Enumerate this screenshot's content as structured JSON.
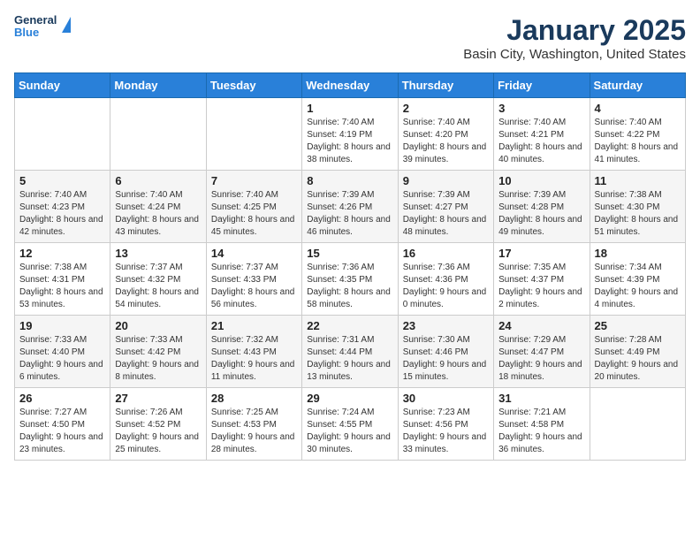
{
  "header": {
    "logo_line1": "General",
    "logo_line2": "Blue",
    "title": "January 2025",
    "subtitle": "Basin City, Washington, United States"
  },
  "calendar": {
    "days_of_week": [
      "Sunday",
      "Monday",
      "Tuesday",
      "Wednesday",
      "Thursday",
      "Friday",
      "Saturday"
    ],
    "weeks": [
      [
        {
          "day": "",
          "content": ""
        },
        {
          "day": "",
          "content": ""
        },
        {
          "day": "",
          "content": ""
        },
        {
          "day": "1",
          "content": "Sunrise: 7:40 AM\nSunset: 4:19 PM\nDaylight: 8 hours and 38 minutes."
        },
        {
          "day": "2",
          "content": "Sunrise: 7:40 AM\nSunset: 4:20 PM\nDaylight: 8 hours and 39 minutes."
        },
        {
          "day": "3",
          "content": "Sunrise: 7:40 AM\nSunset: 4:21 PM\nDaylight: 8 hours and 40 minutes."
        },
        {
          "day": "4",
          "content": "Sunrise: 7:40 AM\nSunset: 4:22 PM\nDaylight: 8 hours and 41 minutes."
        }
      ],
      [
        {
          "day": "5",
          "content": "Sunrise: 7:40 AM\nSunset: 4:23 PM\nDaylight: 8 hours and 42 minutes."
        },
        {
          "day": "6",
          "content": "Sunrise: 7:40 AM\nSunset: 4:24 PM\nDaylight: 8 hours and 43 minutes."
        },
        {
          "day": "7",
          "content": "Sunrise: 7:40 AM\nSunset: 4:25 PM\nDaylight: 8 hours and 45 minutes."
        },
        {
          "day": "8",
          "content": "Sunrise: 7:39 AM\nSunset: 4:26 PM\nDaylight: 8 hours and 46 minutes."
        },
        {
          "day": "9",
          "content": "Sunrise: 7:39 AM\nSunset: 4:27 PM\nDaylight: 8 hours and 48 minutes."
        },
        {
          "day": "10",
          "content": "Sunrise: 7:39 AM\nSunset: 4:28 PM\nDaylight: 8 hours and 49 minutes."
        },
        {
          "day": "11",
          "content": "Sunrise: 7:38 AM\nSunset: 4:30 PM\nDaylight: 8 hours and 51 minutes."
        }
      ],
      [
        {
          "day": "12",
          "content": "Sunrise: 7:38 AM\nSunset: 4:31 PM\nDaylight: 8 hours and 53 minutes."
        },
        {
          "day": "13",
          "content": "Sunrise: 7:37 AM\nSunset: 4:32 PM\nDaylight: 8 hours and 54 minutes."
        },
        {
          "day": "14",
          "content": "Sunrise: 7:37 AM\nSunset: 4:33 PM\nDaylight: 8 hours and 56 minutes."
        },
        {
          "day": "15",
          "content": "Sunrise: 7:36 AM\nSunset: 4:35 PM\nDaylight: 8 hours and 58 minutes."
        },
        {
          "day": "16",
          "content": "Sunrise: 7:36 AM\nSunset: 4:36 PM\nDaylight: 9 hours and 0 minutes."
        },
        {
          "day": "17",
          "content": "Sunrise: 7:35 AM\nSunset: 4:37 PM\nDaylight: 9 hours and 2 minutes."
        },
        {
          "day": "18",
          "content": "Sunrise: 7:34 AM\nSunset: 4:39 PM\nDaylight: 9 hours and 4 minutes."
        }
      ],
      [
        {
          "day": "19",
          "content": "Sunrise: 7:33 AM\nSunset: 4:40 PM\nDaylight: 9 hours and 6 minutes."
        },
        {
          "day": "20",
          "content": "Sunrise: 7:33 AM\nSunset: 4:42 PM\nDaylight: 9 hours and 8 minutes."
        },
        {
          "day": "21",
          "content": "Sunrise: 7:32 AM\nSunset: 4:43 PM\nDaylight: 9 hours and 11 minutes."
        },
        {
          "day": "22",
          "content": "Sunrise: 7:31 AM\nSunset: 4:44 PM\nDaylight: 9 hours and 13 minutes."
        },
        {
          "day": "23",
          "content": "Sunrise: 7:30 AM\nSunset: 4:46 PM\nDaylight: 9 hours and 15 minutes."
        },
        {
          "day": "24",
          "content": "Sunrise: 7:29 AM\nSunset: 4:47 PM\nDaylight: 9 hours and 18 minutes."
        },
        {
          "day": "25",
          "content": "Sunrise: 7:28 AM\nSunset: 4:49 PM\nDaylight: 9 hours and 20 minutes."
        }
      ],
      [
        {
          "day": "26",
          "content": "Sunrise: 7:27 AM\nSunset: 4:50 PM\nDaylight: 9 hours and 23 minutes."
        },
        {
          "day": "27",
          "content": "Sunrise: 7:26 AM\nSunset: 4:52 PM\nDaylight: 9 hours and 25 minutes."
        },
        {
          "day": "28",
          "content": "Sunrise: 7:25 AM\nSunset: 4:53 PM\nDaylight: 9 hours and 28 minutes."
        },
        {
          "day": "29",
          "content": "Sunrise: 7:24 AM\nSunset: 4:55 PM\nDaylight: 9 hours and 30 minutes."
        },
        {
          "day": "30",
          "content": "Sunrise: 7:23 AM\nSunset: 4:56 PM\nDaylight: 9 hours and 33 minutes."
        },
        {
          "day": "31",
          "content": "Sunrise: 7:21 AM\nSunset: 4:58 PM\nDaylight: 9 hours and 36 minutes."
        },
        {
          "day": "",
          "content": ""
        }
      ]
    ]
  }
}
